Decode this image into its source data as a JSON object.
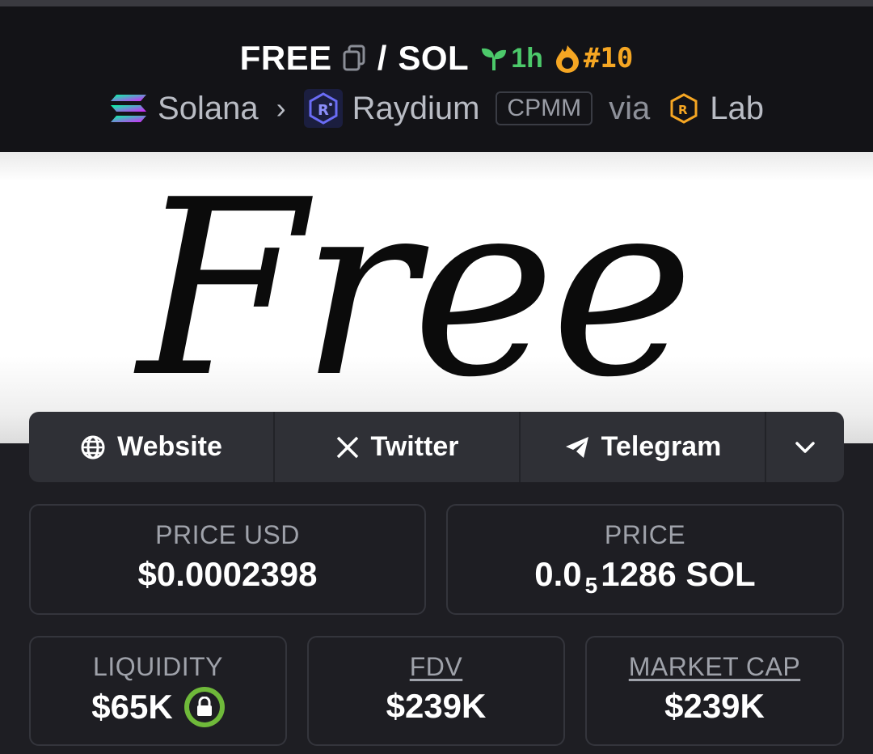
{
  "header": {
    "symbol": "FREE",
    "separator": "/",
    "quote": "SOL",
    "age": "1h",
    "rank": "#10",
    "chain": "Solana",
    "dex": "Raydium",
    "pool_type": "CPMM",
    "via": "via",
    "launchpad": "Lab"
  },
  "banner": {
    "text": "Free"
  },
  "links": {
    "website": "Website",
    "twitter": "Twitter",
    "telegram": "Telegram"
  },
  "stats": {
    "price_usd_label": "PRICE USD",
    "price_usd_value": "$0.0002398",
    "price_label": "PRICE",
    "price_value_prefix": "0.0",
    "price_value_zeros": "5",
    "price_value_suffix": "1286 SOL",
    "liquidity_label": "LIQUIDITY",
    "liquidity_value": "$65K",
    "fdv_label": "FDV",
    "fdv_value": "$239K",
    "mcap_label": "MARKET CAP",
    "mcap_value": "$239K"
  },
  "colors": {
    "accent_green": "#4cc96a",
    "rank_orange": "#f5a623",
    "lock_green": "#6fb93a"
  }
}
